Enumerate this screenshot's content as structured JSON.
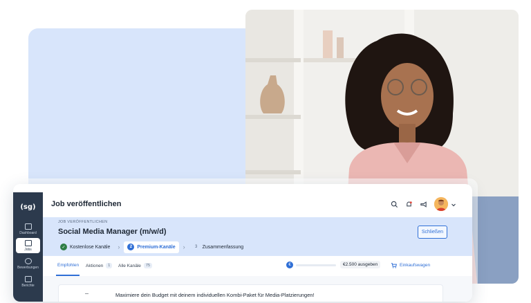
{
  "app": {
    "logo_text": "(sg)",
    "page_title": "Job veröffentlichen"
  },
  "sidebar": {
    "items": [
      {
        "label": "Dashboard",
        "icon": "grid-icon"
      },
      {
        "label": "Jobs",
        "icon": "briefcase-icon"
      },
      {
        "label": "Bewerbungen",
        "icon": "users-icon"
      },
      {
        "label": "Berichte",
        "icon": "chart-icon"
      }
    ]
  },
  "header": {
    "eyebrow": "JOB VERÖFFENTLICHEN",
    "job_title": "Social Media Manager (m/w/d)",
    "close_label": "Schließen"
  },
  "steps": [
    {
      "number": "✓",
      "label": "Kostenlose Kanäle",
      "state": "done"
    },
    {
      "number": "2",
      "label": "Premium-Kanäle",
      "state": "current"
    },
    {
      "number": "3",
      "label": "Zusammenfassung",
      "state": "upcoming"
    }
  ],
  "tabs": [
    {
      "label": "Empfohlen",
      "count": ""
    },
    {
      "label": "Aktionen",
      "count": "1"
    },
    {
      "label": "Alle Kanäle",
      "count": "75"
    }
  ],
  "budget": {
    "label": "€2.500 ausgeben",
    "progress": 0
  },
  "cart": {
    "label": "Einkaufswagen"
  },
  "card": {
    "text": "Maximiere dein Budget mit deinem individuellen Kombi-Paket für Media-Platzierungen!"
  },
  "colors": {
    "accent": "#2f6fd6",
    "sidebar": "#2c3a4d",
    "header_bg": "#d8e5fb",
    "success": "#2e7d45"
  }
}
